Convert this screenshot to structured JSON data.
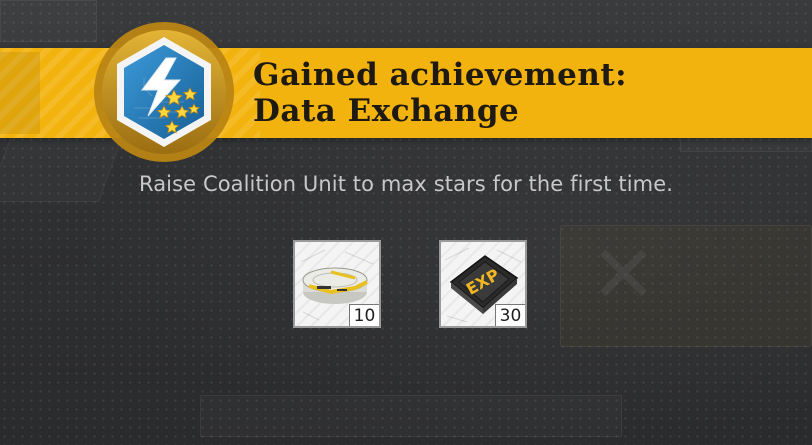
{
  "achievement": {
    "title_line1": "Gained achievement:",
    "title_line2": "Data Exchange",
    "description": "Raise Coalition Unit to max stars for the first time.",
    "badge_icon": "lightning-stars-icon"
  },
  "rewards": [
    {
      "item": "data-disk-icon",
      "count": "10"
    },
    {
      "item": "exp-chip-icon",
      "count": "30"
    }
  ],
  "colors": {
    "banner": "#f3b30f",
    "badge_ring": "#c8961a",
    "badge_inner": "#1f79b8",
    "description_text": "#c8c8c8"
  }
}
